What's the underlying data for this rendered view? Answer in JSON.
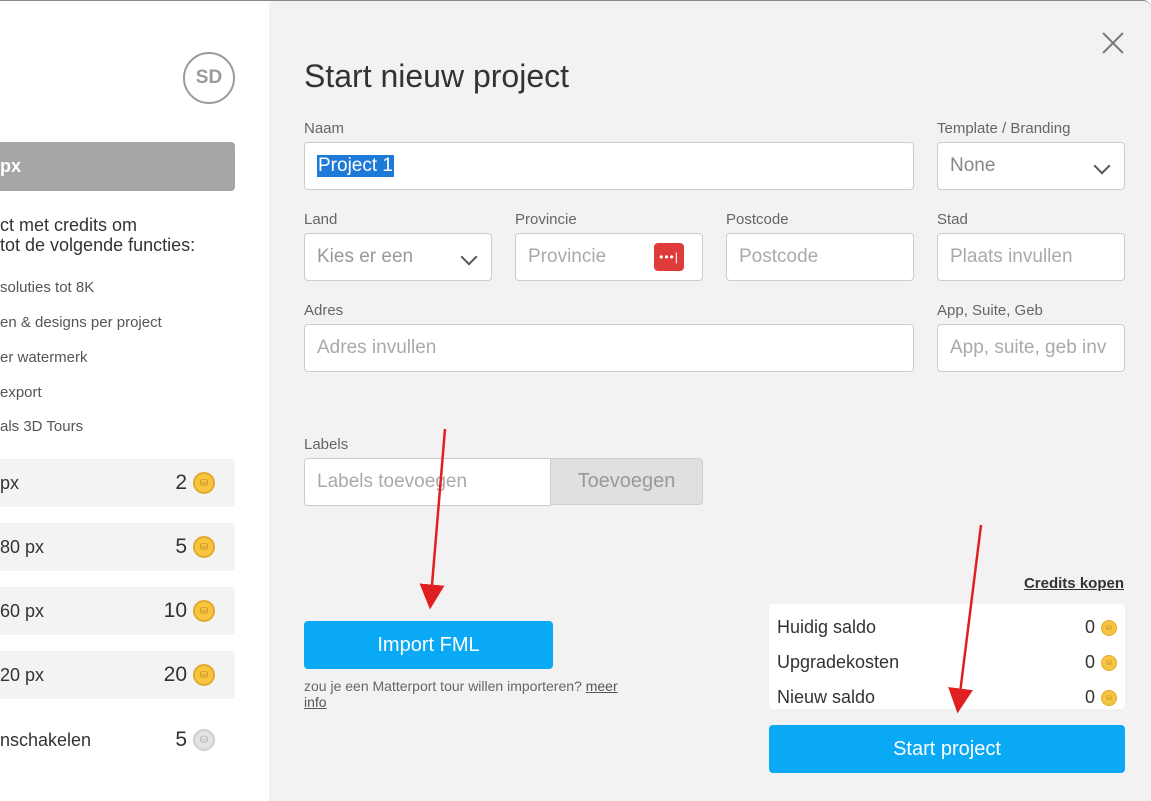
{
  "sidebar": {
    "avatar_initials": "SD",
    "selected_resolution": "px",
    "promo_line1": "ct met credits om",
    "promo_line2": "tot de volgende functies:",
    "features": [
      "soluties tot 8K",
      "en & designs per project",
      "er watermerk",
      "export",
      "als 3D Tours"
    ],
    "resolutions": [
      {
        "label": "px",
        "credits": "2"
      },
      {
        "label": "80 px",
        "credits": "5"
      },
      {
        "label": "60 px",
        "credits": "10"
      },
      {
        "label": "20 px",
        "credits": "20"
      }
    ],
    "extra": {
      "label": "nschakelen",
      "credits": "5"
    }
  },
  "dialog": {
    "title": "Start nieuw project",
    "name": {
      "label": "Naam",
      "value": "Project 1"
    },
    "template": {
      "label": "Template / Branding",
      "value": "None"
    },
    "land": {
      "label": "Land",
      "value": "Kies er een"
    },
    "provincie": {
      "label": "Provincie",
      "placeholder": "Provincie"
    },
    "postcode": {
      "label": "Postcode",
      "placeholder": "Postcode"
    },
    "stad": {
      "label": "Stad",
      "placeholder": "Plaats invullen"
    },
    "adres": {
      "label": "Adres",
      "placeholder": "Adres invullen"
    },
    "suite": {
      "label": "App, Suite, Geb",
      "placeholder": "App, suite, geb inv"
    },
    "labels": {
      "label": "Labels",
      "placeholder": "Labels toevoegen",
      "button": "Toevoegen"
    },
    "import_button": "Import FML",
    "hint_text": "zou je een Matterport tour willen importeren?",
    "hint_link1": "meer",
    "hint_link2": "info",
    "credits_link": "Credits kopen",
    "saldo": [
      {
        "label": "Huidig saldo",
        "value": "0"
      },
      {
        "label": "Upgradekosten",
        "value": "0"
      },
      {
        "label": "Nieuw saldo",
        "value": "0"
      }
    ],
    "start_button": "Start project"
  },
  "colors": {
    "accent": "#0aa9f5",
    "arrow": "#e02020"
  }
}
